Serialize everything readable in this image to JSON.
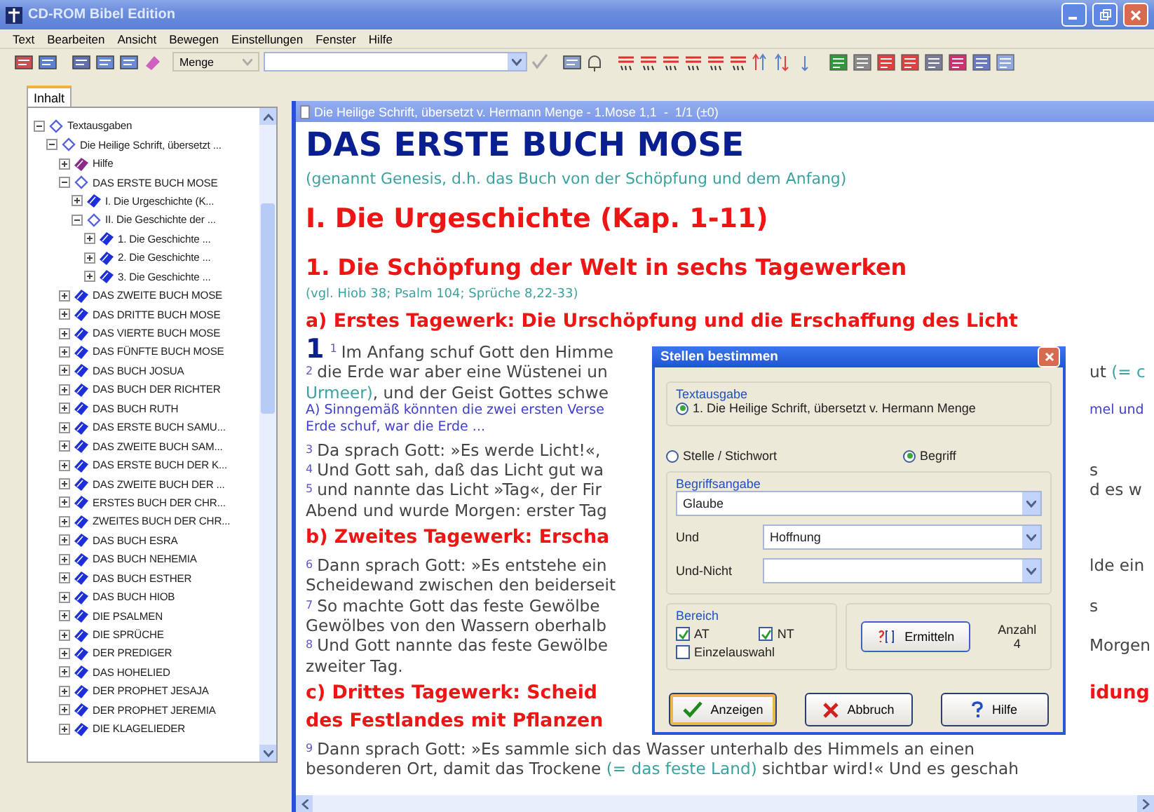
{
  "window": {
    "title": "CD-ROM Bibel Edition"
  },
  "menu": [
    "Text",
    "Bearbeiten",
    "Ansicht",
    "Bewegen",
    "Einstellungen",
    "Fenster",
    "Hilfe"
  ],
  "toolbar": {
    "translation": "Menge"
  },
  "sidebar": {
    "tabs": [
      {
        "label": "Inhalt",
        "selected": true
      }
    ],
    "tree": [
      {
        "label": "Textausgaben",
        "kind": "book",
        "expanded": true,
        "children": [
          {
            "label": "Die Heilige Schrift, übersetzt ...",
            "kind": "book",
            "expanded": true,
            "children": [
              {
                "label": "Hilfe",
                "kind": "help",
                "expanded": false
              },
              {
                "label": "DAS ERSTE BUCH MOSE",
                "kind": "book",
                "expanded": true,
                "children": [
                  {
                    "label": "I. Die Urgeschichte (K...",
                    "kind": "book",
                    "expanded": false
                  },
                  {
                    "label": "II. Die Geschichte der ...",
                    "kind": "book",
                    "expanded": true,
                    "children": [
                      {
                        "label": "1. Die Geschichte ...",
                        "kind": "book",
                        "expanded": false
                      },
                      {
                        "label": "2. Die Geschichte ...",
                        "kind": "book",
                        "expanded": false
                      },
                      {
                        "label": "3. Die Geschichte ...",
                        "kind": "book",
                        "expanded": false
                      }
                    ]
                  }
                ]
              },
              {
                "label": "DAS ZWEITE BUCH MOSE",
                "kind": "book",
                "expanded": false
              },
              {
                "label": "DAS DRITTE BUCH MOSE",
                "kind": "book",
                "expanded": false
              },
              {
                "label": "DAS VIERTE BUCH MOSE",
                "kind": "book",
                "expanded": false
              },
              {
                "label": "DAS FÜNFTE BUCH MOSE",
                "kind": "book",
                "expanded": false
              },
              {
                "label": "DAS BUCH JOSUA",
                "kind": "book",
                "expanded": false
              },
              {
                "label": "DAS BUCH DER RICHTER",
                "kind": "book",
                "expanded": false
              },
              {
                "label": "DAS BUCH RUTH",
                "kind": "book",
                "expanded": false
              },
              {
                "label": "DAS ERSTE BUCH SAMU...",
                "kind": "book",
                "expanded": false
              },
              {
                "label": "DAS ZWEITE BUCH SAM...",
                "kind": "book",
                "expanded": false
              },
              {
                "label": "DAS ERSTE BUCH DER K...",
                "kind": "book",
                "expanded": false
              },
              {
                "label": "DAS ZWEITE BUCH DER ...",
                "kind": "book",
                "expanded": false
              },
              {
                "label": "ERSTES BUCH DER CHR...",
                "kind": "book",
                "expanded": false
              },
              {
                "label": "ZWEITES BUCH DER CHR...",
                "kind": "book",
                "expanded": false
              },
              {
                "label": "DAS BUCH ESRA",
                "kind": "book",
                "expanded": false
              },
              {
                "label": "DAS BUCH NEHEMIA",
                "kind": "book",
                "expanded": false
              },
              {
                "label": "DAS BUCH ESTHER",
                "kind": "book",
                "expanded": false
              },
              {
                "label": "DAS BUCH HIOB",
                "kind": "book",
                "expanded": false
              },
              {
                "label": "DIE PSALMEN",
                "kind": "book",
                "expanded": false
              },
              {
                "label": "DIE SPRÜCHE",
                "kind": "book",
                "expanded": false
              },
              {
                "label": "DER PREDIGER",
                "kind": "book",
                "expanded": false
              },
              {
                "label": "DAS HOHELIED",
                "kind": "book",
                "expanded": false
              },
              {
                "label": "DER PROPHET JESAJA",
                "kind": "book",
                "expanded": false
              },
              {
                "label": "DER PROPHET JEREMIA",
                "kind": "book",
                "expanded": false
              },
              {
                "label": "DIE KLAGELIEDER",
                "kind": "book",
                "expanded": false
              }
            ]
          }
        ]
      }
    ]
  },
  "document": {
    "title": "Die Heilige Schrift, übersetzt v. Hermann Menge - 1.Mose 1,1  -  1/1 (±0)",
    "lines": [
      {
        "kind": "book_title",
        "segments": [
          {
            "kind": "text",
            "text": "DAS ERSTE BUCH MOSE"
          }
        ]
      },
      {
        "kind": "subtitle",
        "segments": [
          {
            "kind": "text",
            "text": "(genannt Genesis, d.h. das Buch von der Schöpfung und dem Anfang)"
          }
        ]
      },
      {
        "kind": "part",
        "segments": [
          {
            "kind": "text",
            "text": "I. Die Urgeschichte (Kap. 1-11)"
          }
        ]
      },
      {
        "kind": "section",
        "segments": [
          {
            "kind": "text",
            "text": "1. Die Schöpfung der Welt in sechs Tagewerken"
          }
        ]
      },
      {
        "kind": "reference",
        "segments": [
          {
            "kind": "text",
            "text": "(vgl. Hiob 38; Psalm 104; Sprüche 8,22-33)"
          }
        ]
      },
      {
        "kind": "pericope",
        "segments": [
          {
            "kind": "text",
            "text": "a) Erstes Tagewerk: Die Urschöpfung und die Erschaffung des Licht"
          }
        ]
      },
      {
        "kind": "verse",
        "segments": [
          {
            "kind": "chapter",
            "text": "1"
          },
          {
            "kind": "verse_no",
            "text": "1"
          },
          {
            "kind": "text",
            "text": "Im Anfang schuf Gott den Himme"
          }
        ]
      },
      {
        "kind": "verse",
        "segments": [
          {
            "kind": "verse_no",
            "text": "2"
          },
          {
            "kind": "text",
            "text": "die Erde war aber eine Wüstenei un"
          }
        ],
        "right": [
          {
            "kind": "text",
            "text": "ut "
          },
          {
            "kind": "gloss",
            "text": "(= c"
          }
        ]
      },
      {
        "kind": "verse",
        "segments": [
          {
            "kind": "gloss",
            "text": "Urmeer)"
          },
          {
            "kind": "text",
            "text": ", und der Geist Gottes schwe"
          }
        ]
      },
      {
        "kind": "footnote",
        "segments": [
          {
            "kind": "text",
            "text": "A) Sinngemäß könnten die zwei ersten Verse"
          }
        ],
        "right": [
          {
            "kind": "text",
            "text": "mel und"
          }
        ]
      },
      {
        "kind": "footnote",
        "segments": [
          {
            "kind": "text",
            "text": "Erde schuf, war die Erde ..."
          }
        ]
      },
      {
        "kind": "verse",
        "segments": [
          {
            "kind": "verse_no",
            "text": "3"
          },
          {
            "kind": "text",
            "text": "Da sprach Gott: »Es werde Licht!«,"
          }
        ]
      },
      {
        "kind": "verse",
        "segments": [
          {
            "kind": "verse_no",
            "text": "4"
          },
          {
            "kind": "text",
            "text": "Und Gott sah, daß das Licht gut wa"
          }
        ],
        "right": [
          {
            "kind": "text",
            "text": "s"
          }
        ]
      },
      {
        "kind": "verse",
        "segments": [
          {
            "kind": "verse_no",
            "text": "5"
          },
          {
            "kind": "text",
            "text": "und nannte das Licht »Tag«, der Fir"
          }
        ],
        "right": [
          {
            "kind": "text",
            "text": "d es w"
          }
        ]
      },
      {
        "kind": "verse",
        "segments": [
          {
            "kind": "text",
            "text": "Abend und wurde Morgen: erster Tag"
          }
        ]
      },
      {
        "kind": "pericope",
        "segments": [
          {
            "kind": "text",
            "text": "b) Zweites Tagewerk: Erscha"
          }
        ]
      },
      {
        "kind": "verse",
        "segments": [
          {
            "kind": "verse_no",
            "text": "6"
          },
          {
            "kind": "text",
            "text": "Dann sprach Gott: »Es entstehe ein"
          }
        ],
        "right": [
          {
            "kind": "text",
            "text": "lde ein"
          }
        ]
      },
      {
        "kind": "verse",
        "segments": [
          {
            "kind": "text",
            "text": "Scheidewand zwischen den beiderseit"
          }
        ]
      },
      {
        "kind": "verse",
        "segments": [
          {
            "kind": "verse_no",
            "text": "7"
          },
          {
            "kind": "text",
            "text": "So machte Gott das feste Gewölbe"
          }
        ],
        "right": [
          {
            "kind": "text",
            "text": "s"
          }
        ]
      },
      {
        "kind": "verse",
        "segments": [
          {
            "kind": "text",
            "text": "Gewölbes von den Wassern oberhalb"
          }
        ]
      },
      {
        "kind": "verse",
        "segments": [
          {
            "kind": "verse_no",
            "text": "8"
          },
          {
            "kind": "text",
            "text": "Und Gott nannte das feste Gewölbe"
          }
        ],
        "right": [
          {
            "kind": "text",
            "text": "Morgen"
          }
        ]
      },
      {
        "kind": "verse",
        "segments": [
          {
            "kind": "text",
            "text": "zweiter Tag."
          }
        ]
      },
      {
        "kind": "pericope",
        "segments": [
          {
            "kind": "text",
            "text": "c) Drittes Tagewerk: Scheid"
          }
        ],
        "right": [
          {
            "kind": "text",
            "text": "idung"
          }
        ]
      },
      {
        "kind": "pericope",
        "segments": [
          {
            "kind": "text",
            "text": "des Festlandes mit Pflanzen"
          }
        ]
      },
      {
        "kind": "verse",
        "segments": [
          {
            "kind": "verse_no",
            "text": "9"
          },
          {
            "kind": "text",
            "text": "Dann sprach Gott: »Es sammle sich das Wasser unterhalb des Himmels an einen"
          }
        ]
      },
      {
        "kind": "verse",
        "segments": [
          {
            "kind": "text",
            "text": "besonderen Ort, damit das Trockene "
          },
          {
            "kind": "gloss",
            "text": "(= das feste Land)"
          },
          {
            "kind": "text",
            "text": " sichtbar wird!« Und es geschah"
          }
        ]
      }
    ]
  },
  "dialog": {
    "title": "Stellen bestimmen",
    "edition_group": {
      "label": "Textausgabe",
      "options": [
        {
          "label": "1. Die Heilige Schrift, übersetzt v. Hermann Menge",
          "selected": true
        }
      ]
    },
    "mode_options": [
      {
        "label": "Stelle / Stichwort",
        "selected": false
      },
      {
        "label": "Begriff",
        "selected": true
      }
    ],
    "term_group": {
      "label": "Begriffsangabe",
      "term": "Glaube",
      "fields": [
        {
          "label": "Und",
          "value": "Hoffnung"
        },
        {
          "label": "Und-Nicht"
        }
      ]
    },
    "range_group": {
      "label": "Bereich",
      "checks": [
        {
          "label": "AT",
          "checked": true
        },
        {
          "label": "NT",
          "checked": true
        },
        {
          "label": "Einzelauswahl",
          "checked": false
        }
      ]
    },
    "count_button": "Ermitteln",
    "count_label": "Anzahl",
    "count": "4",
    "buttons": [
      {
        "label": "Anzeigen",
        "kind": "ok"
      },
      {
        "label": "Abbruch",
        "kind": "cancel"
      },
      {
        "label": "Hilfe",
        "kind": "help"
      }
    ]
  }
}
